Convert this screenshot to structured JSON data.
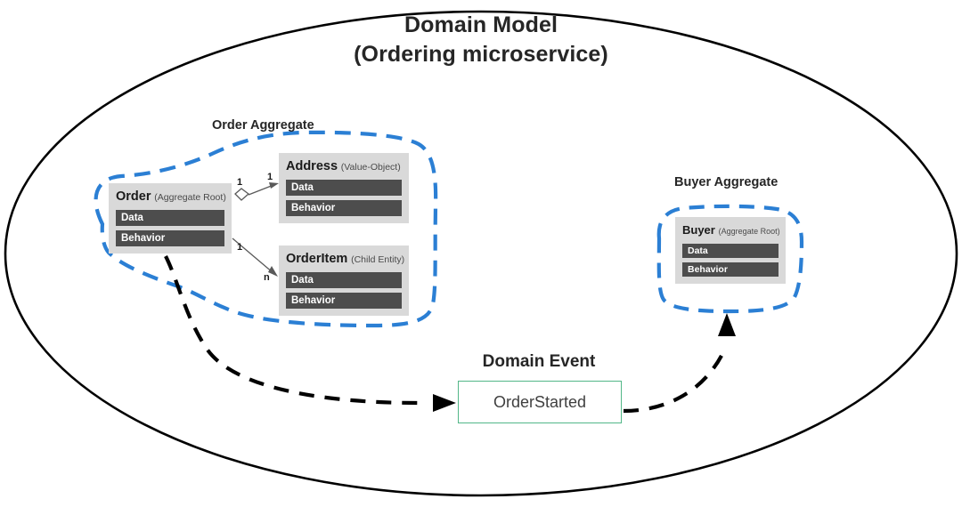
{
  "diagram": {
    "title_line1": "Domain Model",
    "title_line2": "(Ordering microservice)",
    "boundary_shape": "ellipse",
    "colors": {
      "boundary_stroke": "#000000",
      "aggregate_dashed": "#2b7fd4",
      "card_background": "#d9d9d9",
      "member_bar": "#4d4d4d",
      "member_bar_text": "#ffffff",
      "event_border": "#52b788",
      "relation_line": "#595959",
      "flow_arrow": "#000000",
      "text": "#262626"
    }
  },
  "aggregates": [
    {
      "label": "Order Aggregate",
      "entities": [
        {
          "name": "Order",
          "stereotype": "(Aggregate Root)",
          "members": [
            "Data",
            "Behavior"
          ]
        },
        {
          "name": "Address",
          "stereotype": "(Value-Object)",
          "members": [
            "Data",
            "Behavior"
          ]
        },
        {
          "name": "OrderItem",
          "stereotype": "(Child Entity)",
          "members": [
            "Data",
            "Behavior"
          ]
        }
      ]
    },
    {
      "label": "Buyer Aggregate",
      "entities": [
        {
          "name": "Buyer",
          "stereotype": "(Aggregate Root)",
          "members": [
            "Data",
            "Behavior"
          ]
        }
      ]
    }
  ],
  "relations": [
    {
      "from": "Order",
      "to": "Address",
      "type": "aggregation",
      "source_multiplicity": "1",
      "target_multiplicity": "1"
    },
    {
      "from": "Order",
      "to": "OrderItem",
      "type": "association",
      "source_multiplicity": "1",
      "target_multiplicity": "n"
    }
  ],
  "domain_event": {
    "label": "Domain Event",
    "name": "OrderStarted",
    "publisher": "Order",
    "subscriber": "Buyer"
  }
}
